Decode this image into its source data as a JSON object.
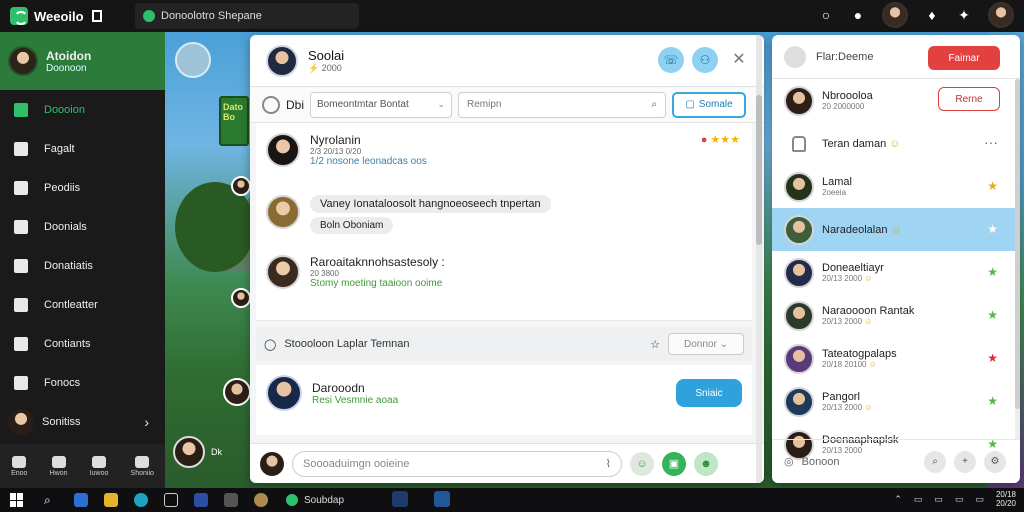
{
  "topbar": {
    "app_title": "Weeoilo",
    "channel": "Donoolotro Shepane"
  },
  "sidebar": {
    "profile": {
      "name": "Atoidon",
      "status": "Doonoon"
    },
    "items": [
      {
        "label": "Doooion",
        "icon": "home-icon",
        "active": true
      },
      {
        "label": "Fagalt",
        "icon": "person-icon",
        "active": false
      },
      {
        "label": "Peodiis",
        "icon": "people-icon",
        "active": false
      },
      {
        "label": "Doonials",
        "icon": "chat-icon",
        "active": false
      },
      {
        "label": "Donatiatis",
        "icon": "store-icon",
        "active": false
      },
      {
        "label": "Contleatter",
        "icon": "edit-icon",
        "active": false
      },
      {
        "label": "Contiants",
        "icon": "car-icon",
        "active": false
      },
      {
        "label": "Fonocs",
        "icon": "calendar-icon",
        "active": false
      },
      {
        "label": "Sonitiss",
        "icon": "user-avatar",
        "active": false
      }
    ],
    "bottom": [
      "Enoo",
      "Hwon",
      "Iuwoo",
      "Shoniio"
    ]
  },
  "game": {
    "sign_text": "Dato Bo",
    "user_label": "Dk"
  },
  "center": {
    "title": "Soolai",
    "subtitle": "2000",
    "toolbar": {
      "tab_label": "Dbi",
      "select_value": "Bomeontmtar Bontat",
      "search_placeholder": "Remipn",
      "action_label": "Somale"
    },
    "messages": [
      {
        "name": "Nyrolanin",
        "time": "2/3 20/13 0/20",
        "text": "1/2 nosone leonadcas oos"
      },
      {
        "bubble": "Vaney Ionataloosolt hangnoeoseech tnpertan",
        "bubble2": "Boln Oboniam"
      },
      {
        "name": "Raroaitaknnohsastesoly :",
        "time": "20 3800",
        "text": "Stomy moeting taaioon ooime"
      }
    ],
    "subbar": {
      "label": "Stoooloon Laplar Temnan",
      "dropdown": "Donnor"
    },
    "card": {
      "name": "Darooodn",
      "text": "Resi Vesmnie aoaa",
      "button": "Sniaic"
    },
    "composer_placeholder": "Soooaduimgn ooieine"
  },
  "right": {
    "header_label": "Flar:Deeme",
    "header_button": "Faimar",
    "friends": [
      {
        "name": "Nbroooloa",
        "sub": "20 2000000",
        "button": "Rerne"
      },
      {
        "name": "Teran daman",
        "sub": "",
        "locked": true
      },
      {
        "name": "Lamal",
        "sub": "2oeeia",
        "star": "#e2b018"
      },
      {
        "name": "Naradeolalan",
        "sub": "",
        "star": "#ffffff",
        "selected": true
      },
      {
        "name": "Doneaeltiayr",
        "sub": "20/13 2000",
        "star": "#5ab34f"
      },
      {
        "name": "Naraoooon Rantak",
        "sub": "20/13 2000",
        "star": "#5ab34f"
      },
      {
        "name": "Tateatogpalaps",
        "sub": "20/18 20100",
        "star": "#d9323f"
      },
      {
        "name": "Pangorl",
        "sub": "20/13 2000",
        "star": "#5ab34f"
      },
      {
        "name": "Doenaaphaplsk",
        "sub": "20/13 2000",
        "star": "#5ab34f"
      }
    ],
    "footer_placeholder": "Bonoon"
  },
  "taskbar": {
    "active_app": "Soubdap",
    "clock_line1": "20/18",
    "clock_line2": "20/20"
  }
}
